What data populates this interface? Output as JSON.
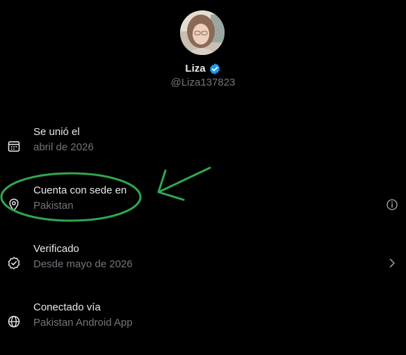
{
  "profile": {
    "name": "Liza",
    "handle": "@Liza137823",
    "verified": true,
    "badge_color": "#1d9bf0"
  },
  "info_rows": [
    {
      "icon": "calendar-icon",
      "title": "Se unió el",
      "subtitle": "abril de 2026"
    },
    {
      "icon": "location-pin-icon",
      "title": "Cuenta con sede en",
      "subtitle": "Pakistan",
      "trailing_icon": "info-icon"
    },
    {
      "icon": "verified-check-icon",
      "title": "Verificado",
      "subtitle": "Desde mayo de 2026",
      "trailing_icon": "chevron-right-icon"
    },
    {
      "icon": "globe-icon",
      "title": "Conectado vía",
      "subtitle": "Pakistan Android App"
    }
  ],
  "annotation": {
    "highlight_color": "#2fa84f",
    "shapes": [
      "highlight-ellipse",
      "arrow"
    ]
  },
  "colors": {
    "background": "#000000",
    "primary_text": "#e7e9ea",
    "secondary_text": "#71767b"
  }
}
